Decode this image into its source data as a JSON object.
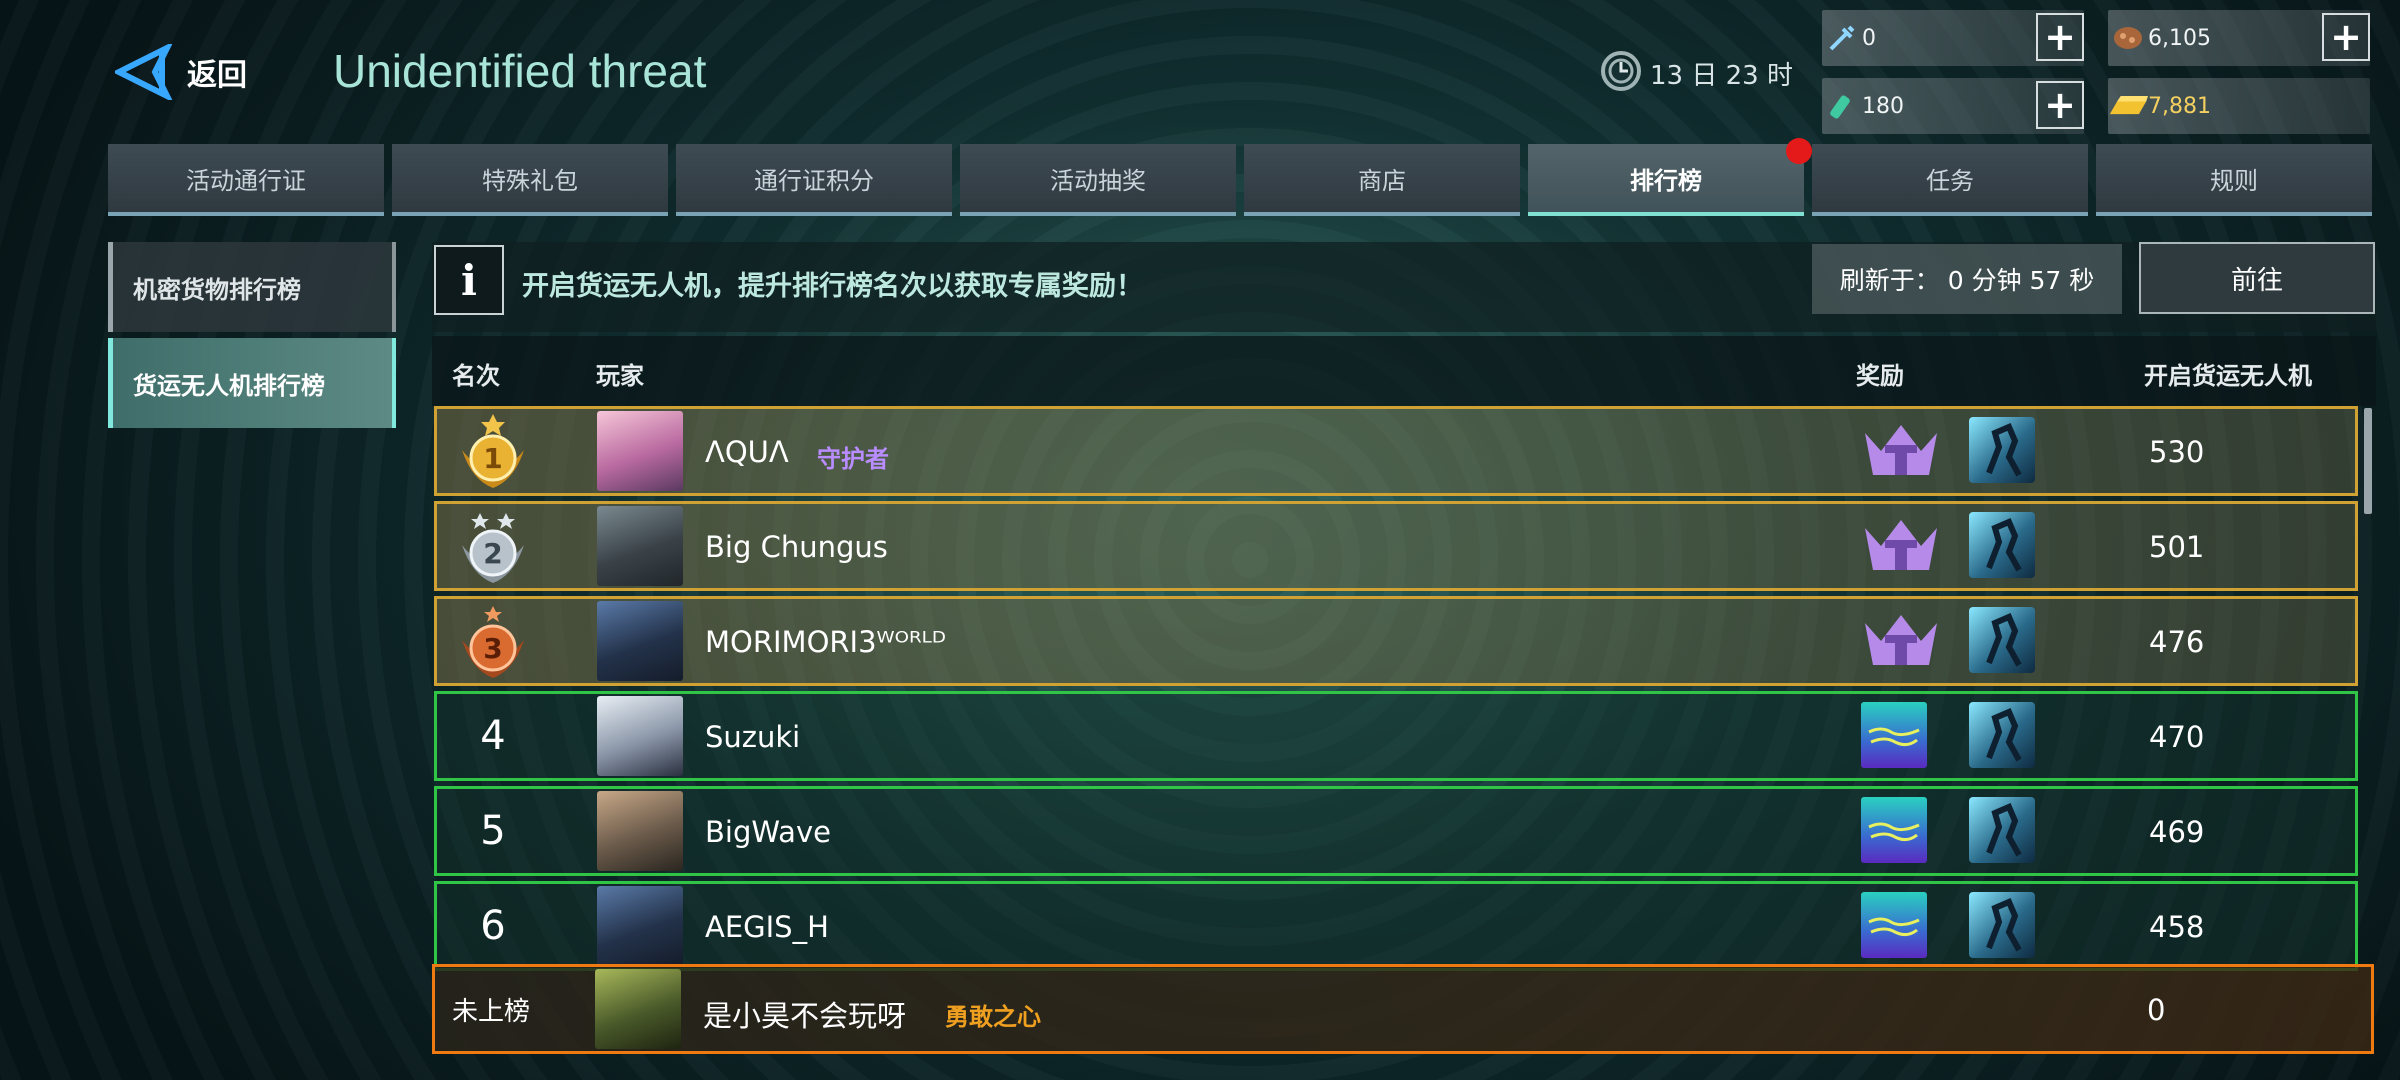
{
  "header": {
    "back_label": "返回",
    "title": "Unidentified threat",
    "timer": "13 日 23 时"
  },
  "currencies": [
    {
      "icon": "syringe-icon",
      "value": "0"
    },
    {
      "icon": "ore-icon",
      "value": "6,105"
    },
    {
      "icon": "vial-icon",
      "value": "180"
    },
    {
      "icon": "gold-bar-icon",
      "value": "7,881"
    }
  ],
  "tabs": [
    {
      "label": "活动通行证"
    },
    {
      "label": "特殊礼包"
    },
    {
      "label": "通行证积分"
    },
    {
      "label": "活动抽奖"
    },
    {
      "label": "商店"
    },
    {
      "label": "排行榜",
      "active": true,
      "badge": true
    },
    {
      "label": "任务"
    },
    {
      "label": "规则"
    }
  ],
  "sidebar": {
    "items": [
      {
        "label": "机密货物排行榜"
      },
      {
        "label": "货运无人机排行榜",
        "active": true
      }
    ]
  },
  "info": {
    "text": "开启货运无人机，提升排行榜名次以获取专属奖励！",
    "refresh_label": "刷新于：",
    "refresh_time": "0 分钟 57 秒",
    "goto_label": "前往"
  },
  "table": {
    "headers": {
      "rank": "名次",
      "player": "玩家",
      "reward": "奖励",
      "score": "开启货运无人机"
    },
    "rows": [
      {
        "rank": "1",
        "name": "ΛQUΛ",
        "title": "守护者",
        "title_color": "#b98cff",
        "score": "530",
        "tier": "gold"
      },
      {
        "rank": "2",
        "name": "Big Chungus",
        "title": "",
        "score": "501",
        "tier": "gold"
      },
      {
        "rank": "3",
        "name": "MORIMORI3ᵂᴼᴿᴸᴰ",
        "title": "",
        "score": "476",
        "tier": "gold"
      },
      {
        "rank": "4",
        "name": "Suzuki",
        "title": "",
        "score": "470",
        "tier": "green"
      },
      {
        "rank": "5",
        "name": "BigWave",
        "title": "",
        "score": "469",
        "tier": "green"
      },
      {
        "rank": "6",
        "name": "AEGIS_H",
        "title": "",
        "score": "458",
        "tier": "green"
      }
    ],
    "me": {
      "rank": "未上榜",
      "name": "是小昊不会玩呀",
      "title": "勇敢之心",
      "title_color": "#f0a020",
      "score": "0"
    }
  },
  "colors": {
    "accent": "#80e0d2",
    "gold_border": "#cfa233",
    "green_border": "#31c545",
    "me_border": "#f07a12",
    "badge": "#e41919"
  }
}
